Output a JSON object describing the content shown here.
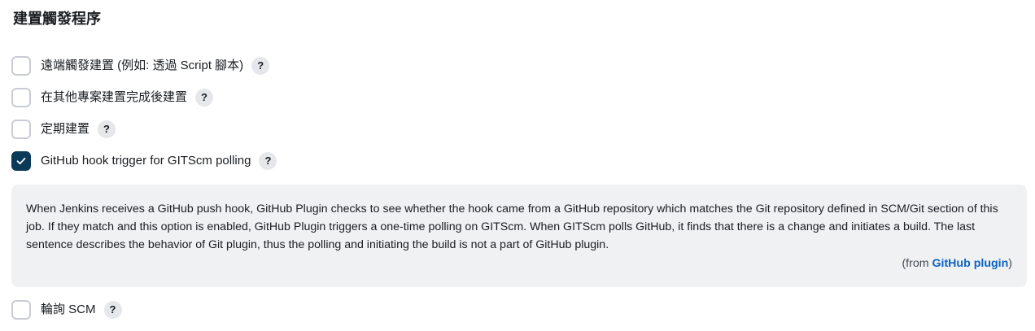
{
  "section": {
    "title": "建置觸發程序"
  },
  "options": [
    {
      "label": "遠端觸發建置 (例如: 透過 Script 腳本)",
      "checked": false
    },
    {
      "label": "在其他專案建置完成後建置",
      "checked": false
    },
    {
      "label": "定期建置",
      "checked": false
    },
    {
      "label": "GitHub hook trigger for GITScm polling",
      "checked": true
    },
    {
      "label": "輪詢 SCM",
      "checked": false
    }
  ],
  "help_icon": {
    "glyph": "?",
    "icon": "help-icon"
  },
  "help_panel": {
    "text": "When Jenkins receives a GitHub push hook, GitHub Plugin checks to see whether the hook came from a GitHub repository which matches the Git repository defined in SCM/Git section of this job. If they match and this option is enabled, GitHub Plugin triggers a one-time polling on GITScm. When GITScm polls GitHub, it finds that there is a change and initiates a build. The last sentence describes the behavior of Git plugin, thus the polling and initiating the build is not a part of GitHub plugin.",
    "source_prefix": "(from ",
    "source_link": "GitHub plugin",
    "source_suffix": ")"
  },
  "colors": {
    "checked_bg": "#0b3a59",
    "link": "#0b63c4",
    "panel_bg": "#f0f1f3"
  }
}
